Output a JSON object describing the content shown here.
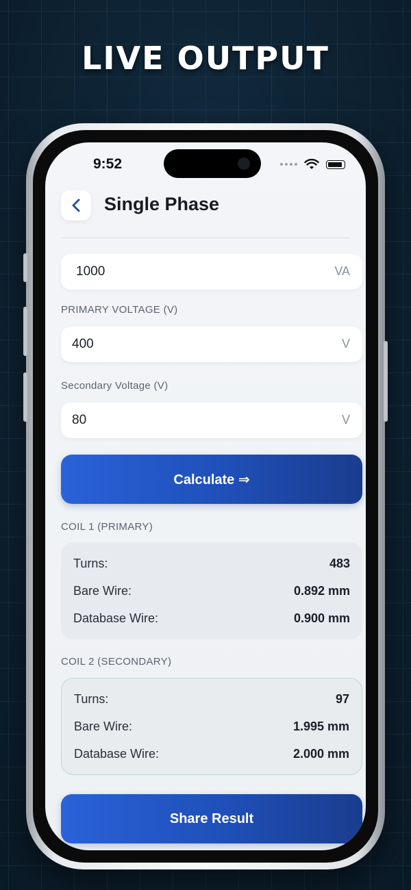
{
  "headline": "LIVE OUTPUT",
  "status_bar": {
    "time": "9:52"
  },
  "header": {
    "title": "Single Phase"
  },
  "fields": {
    "power": {
      "value": "1000",
      "unit": "VA"
    },
    "primary_voltage": {
      "label": "PRIMARY VOLTAGE (V)",
      "value": "400",
      "unit": "V"
    },
    "secondary_voltage": {
      "label": "Secondary Voltage (V)",
      "value": "80",
      "unit": "V"
    }
  },
  "calculate_button": "Calculate ⇒",
  "coil1": {
    "heading": "COIL 1 (PRIMARY)",
    "rows": [
      {
        "label": "Turns:",
        "value": "483"
      },
      {
        "label": "Bare Wire:",
        "value": "0.892 mm"
      },
      {
        "label": "Database Wire:",
        "value": "0.900 mm"
      }
    ]
  },
  "coil2": {
    "heading": "COIL 2 (SECONDARY)",
    "rows": [
      {
        "label": "Turns:",
        "value": "97"
      },
      {
        "label": "Bare Wire:",
        "value": "1.995 mm"
      },
      {
        "label": "Database Wire:",
        "value": "2.000 mm"
      }
    ]
  },
  "share_button": "Share Result",
  "colors": {
    "accent": "#2a62d8",
    "accent_dark": "#1a3d8e",
    "background": "#0f2536"
  },
  "icons": [
    "back-chevron-icon",
    "wifi-icon",
    "battery-icon",
    "signal-dots-icon"
  ]
}
